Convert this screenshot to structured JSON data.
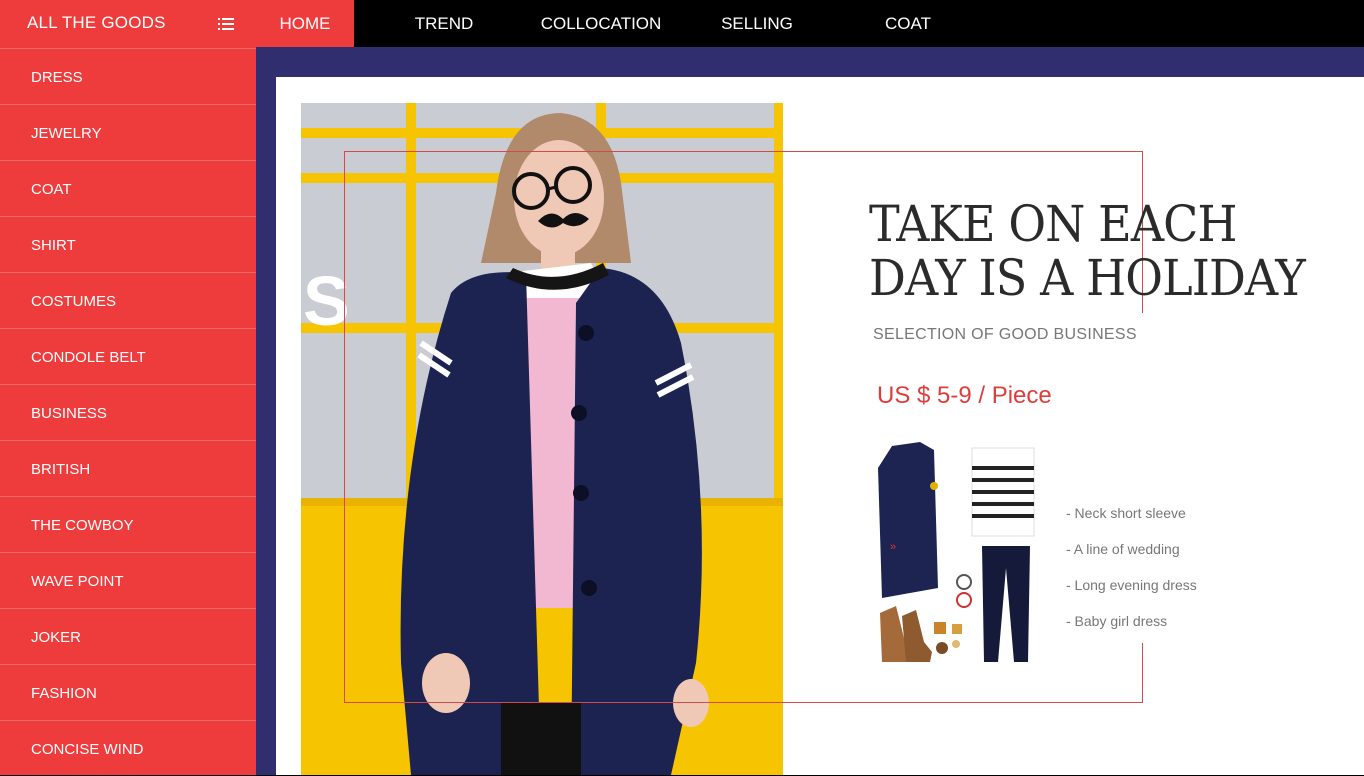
{
  "topbar": {
    "all_goods": "ALL THE GOODS",
    "menu_icon": "list-icon",
    "nav": [
      {
        "label": "HOME",
        "active": true
      },
      {
        "label": "TREND"
      },
      {
        "label": "COLLOCATION"
      },
      {
        "label": "SELLING"
      },
      {
        "label": "COAT"
      }
    ]
  },
  "sidebar": {
    "items": [
      {
        "label": "DRESS"
      },
      {
        "label": "JEWELRY"
      },
      {
        "label": "COAT"
      },
      {
        "label": "SHIRT"
      },
      {
        "label": "COSTUMES"
      },
      {
        "label": "CONDOLE BELT"
      },
      {
        "label": "BUSINESS"
      },
      {
        "label": "BRITISH"
      },
      {
        "label": "THE COWBOY"
      },
      {
        "label": "WAVE POINT"
      },
      {
        "label": "JOKER"
      },
      {
        "label": "FASHION"
      },
      {
        "label": "CONCISE WIND"
      }
    ]
  },
  "hero": {
    "headline_line1": "TAKE ON EACH",
    "headline_line2": "DAY IS A HOLIDAY",
    "subheading": "SELECTION OF GOOD BUSINESS",
    "price": "US $ 5-9 / Piece",
    "features": [
      "-  Neck short sleeve",
      "-  A line of wedding",
      "-  Long evening dress",
      "-  Baby girl dress"
    ]
  },
  "colors": {
    "accent_red": "#ee3b3b",
    "navy": "#302e6e",
    "black": "#000000",
    "price_red": "#e03c3c"
  }
}
